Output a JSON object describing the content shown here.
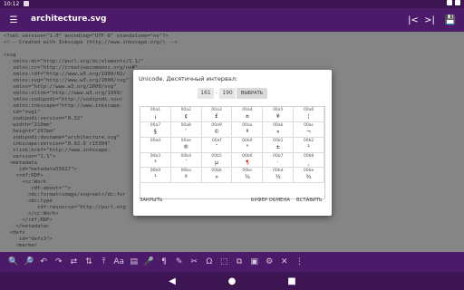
{
  "status_bar": {
    "time": "10:12"
  },
  "app_bar": {
    "title": "architecture.svg"
  },
  "icons": {
    "menu": "menu-icon",
    "prev": "prev-icon",
    "next": "next-icon",
    "save": "save-icon"
  },
  "editor": {
    "lines": [
      "<?xml version=\"1.0\" encoding=\"UTF-8\" standalone=\"no\"?>",
      "<!-- Created with Inkscape (http://www.inkscape.org/) -->",
      "",
      "<svg",
      "   xmlns:dc=\"http://purl.org/dc/elements/1.1/\"",
      "   xmlns:cc=\"http://creativecommons.org/ns#\"",
      "   xmlns:rdf=\"http://www.w3.org/1999/02/",
      "   xmlns:svg=\"http://www.w3.org/2000/svg\"",
      "   xmlns=\"http://www.w3.org/2000/svg\"",
      "   xmlns:xlink=\"http://www.w3.org/1999/",
      "   xmlns:sodipodi=\"http://sodipodi.sour",
      "   xmlns:inkscape=\"http://www.inkscape.",
      "   id=\"svg1\"",
      "   sodipodi:version=\"0.32\"",
      "   width=\"210mm\"",
      "   height=\"297mm\"",
      "   sodipodi:docname=\"architecture.svg\"",
      "   inkscape:version=\"0.92.0 r15304\"",
      "   xlink:href=\"http://www.inkscape.",
      "   version=\"1.1\">",
      "  <metadata",
      "     id=\"metadata55627\">",
      "    <rdf:RDF>",
      "      <cc:Work",
      "         rdf:about=\"\">",
      "        <dc:format>image/svg+xml</dc:for",
      "        <dc:type",
      "           rdf:resource=\"http://purl.org",
      "        </cc:Work>",
      "      </rdf:RDF>",
      "    </metadata>",
      "  <defs",
      "     id=\"defs3\">",
      "    <marker"
    ]
  },
  "dialog": {
    "title": "Unicode. Десятичный интервал:",
    "range_from": "161",
    "range_dash": "-",
    "range_to": "190",
    "choose_label": "ВЫБРАТЬ",
    "cells": [
      {
        "code": "00a1",
        "glyph": "¡"
      },
      {
        "code": "00a2",
        "glyph": "¢"
      },
      {
        "code": "00a3",
        "glyph": "£"
      },
      {
        "code": "00a4",
        "glyph": "¤"
      },
      {
        "code": "00a5",
        "glyph": "¥"
      },
      {
        "code": "00a6",
        "glyph": "¦"
      },
      {
        "code": "00a7",
        "glyph": "§"
      },
      {
        "code": "00a8",
        "glyph": "¨"
      },
      {
        "code": "00a9",
        "glyph": "©"
      },
      {
        "code": "00aa",
        "glyph": "ª"
      },
      {
        "code": "00ab",
        "glyph": "«"
      },
      {
        "code": "00ac",
        "glyph": "¬"
      },
      {
        "code": "00ad",
        "glyph": ""
      },
      {
        "code": "00ae",
        "glyph": "®"
      },
      {
        "code": "00af",
        "glyph": "¯"
      },
      {
        "code": "00b0",
        "glyph": "°"
      },
      {
        "code": "00b1",
        "glyph": "±"
      },
      {
        "code": "00b2",
        "glyph": "²"
      },
      {
        "code": "00b3",
        "glyph": "³"
      },
      {
        "code": "00b4",
        "glyph": "´"
      },
      {
        "code": "00b5",
        "glyph": "µ"
      },
      {
        "code": "00b6",
        "glyph": "¶"
      },
      {
        "code": "00b7",
        "glyph": "·"
      },
      {
        "code": "00b8",
        "glyph": "¸"
      },
      {
        "code": "00b9",
        "glyph": "¹"
      },
      {
        "code": "00ba",
        "glyph": "º"
      },
      {
        "code": "00bb",
        "glyph": "»"
      },
      {
        "code": "00bc",
        "glyph": "¼"
      },
      {
        "code": "00bd",
        "glyph": "½"
      },
      {
        "code": "00be",
        "glyph": "¾"
      }
    ],
    "close_label": "ЗАКРЫТЬ",
    "clipboard_label": "БУФЕР ОБМЕНА",
    "paste_label": "ВСТАВИТЬ"
  },
  "toolbar": {
    "items": [
      {
        "name": "search-icon",
        "glyph": "🔍"
      },
      {
        "name": "search-replace-icon",
        "glyph": "🔎"
      },
      {
        "name": "undo-icon",
        "glyph": "↶"
      },
      {
        "name": "redo-icon",
        "glyph": "↷"
      },
      {
        "name": "swap-icon",
        "glyph": "⇄"
      },
      {
        "name": "insert-icon",
        "glyph": "⇅"
      },
      {
        "name": "jump-icon",
        "glyph": "⤒"
      },
      {
        "name": "font-size-icon",
        "glyph": "Aa"
      },
      {
        "name": "keyboard-icon",
        "glyph": "▤"
      },
      {
        "name": "microphone-icon",
        "glyph": "🎤"
      },
      {
        "name": "format-icon",
        "glyph": "¶"
      },
      {
        "name": "edit-icon",
        "glyph": "✎"
      },
      {
        "name": "tools-icon",
        "glyph": "✂"
      },
      {
        "name": "unicode-icon",
        "glyph": "Ω"
      },
      {
        "name": "select-icon",
        "glyph": "⬚"
      },
      {
        "name": "copy-icon",
        "glyph": "⧉"
      },
      {
        "name": "paste-icon",
        "glyph": "▣"
      },
      {
        "name": "settings-icon",
        "glyph": "⚙"
      },
      {
        "name": "close-icon",
        "glyph": "✕"
      },
      {
        "name": "more-icon",
        "glyph": "⋮"
      }
    ]
  },
  "nav": {
    "back": "back-icon",
    "home": "home-icon",
    "recents": "recents-icon"
  }
}
